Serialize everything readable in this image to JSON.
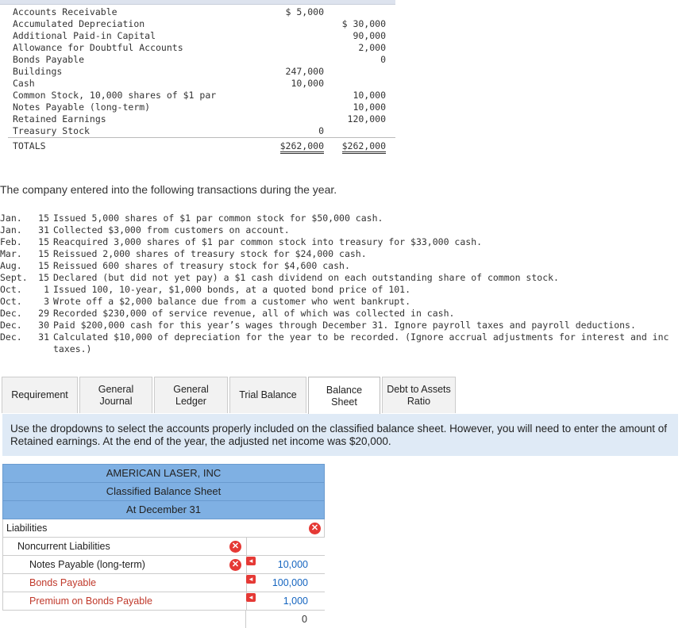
{
  "trial_balance": {
    "rows": [
      {
        "account": "Accounts Receivable",
        "debit": "$ 5,000",
        "credit": ""
      },
      {
        "account": "Accumulated Depreciation",
        "debit": "",
        "credit": "$ 30,000"
      },
      {
        "account": "Additional Paid-in Capital",
        "debit": "",
        "credit": "90,000"
      },
      {
        "account": "Allowance for Doubtful Accounts",
        "debit": "",
        "credit": "2,000"
      },
      {
        "account": "Bonds Payable",
        "debit": "",
        "credit": "0"
      },
      {
        "account": "Buildings",
        "debit": "247,000",
        "credit": ""
      },
      {
        "account": "Cash",
        "debit": "10,000",
        "credit": ""
      },
      {
        "account": "Common Stock, 10,000 shares of $1 par",
        "debit": "",
        "credit": "10,000"
      },
      {
        "account": "Notes Payable (long-term)",
        "debit": "",
        "credit": "10,000"
      },
      {
        "account": "Retained Earnings",
        "debit": "",
        "credit": "120,000"
      },
      {
        "account": "Treasury Stock",
        "debit": "0",
        "credit": ""
      }
    ],
    "totals": {
      "label": "TOTALS",
      "debit": "$262,000",
      "credit": "$262,000"
    }
  },
  "intro": "The company entered into the following transactions during the year.",
  "transactions": [
    {
      "month": "Jan.",
      "day": "15",
      "text": "Issued 5,000 shares of $1 par common stock for $50,000 cash."
    },
    {
      "month": "Jan.",
      "day": "31",
      "text": "Collected $3,000 from customers on account."
    },
    {
      "month": "Feb.",
      "day": "15",
      "text": "Reacquired 3,000 shares of $1 par common stock into treasury for $33,000 cash."
    },
    {
      "month": "Mar.",
      "day": "15",
      "text": "Reissued 2,000 shares of treasury stock for $24,000 cash."
    },
    {
      "month": "Aug.",
      "day": "15",
      "text": "Reissued 600 shares of treasury stock for $4,600 cash."
    },
    {
      "month": "Sept.",
      "day": "15",
      "text": "Declared (but did not yet pay) a $1 cash dividend on each outstanding share of common stock."
    },
    {
      "month": "Oct.",
      "day": "1",
      "text": "Issued 100, 10-year, $1,000 bonds, at a quoted bond price of 101."
    },
    {
      "month": "Oct.",
      "day": "3",
      "text": "Wrote off a $2,000 balance due from a customer who went bankrupt."
    },
    {
      "month": "Dec.",
      "day": "29",
      "text": "Recorded $230,000 of service revenue, all of which was collected in cash."
    },
    {
      "month": "Dec.",
      "day": "30",
      "text": "Paid $200,000 cash for this year’s wages through December 31. Ignore payroll taxes and payroll deductions."
    },
    {
      "month": "Dec.",
      "day": "31",
      "text": "Calculated $10,000 of depreciation for the year to be recorded. (Ignore accrual adjustments for interest and inc"
    },
    {
      "month": "",
      "day": "",
      "text": "taxes.)"
    }
  ],
  "tabs": [
    {
      "label": "Requirement"
    },
    {
      "label": "General Journal"
    },
    {
      "label": "General Ledger"
    },
    {
      "label": "Trial Balance"
    },
    {
      "label": "Balance Sheet"
    },
    {
      "label": "Debt to Assets Ratio"
    }
  ],
  "instructions": "Use the dropdowns to select the accounts properly included on the classified balance sheet. However, you will need to enter the amount of Retained earnings. At the end of the year, the adjusted net income was $20,000.",
  "balance_sheet": {
    "company": "AMERICAN LASER, INC",
    "title": "Classified Balance Sheet",
    "date": "At December 31",
    "section": "Liabilities",
    "subsection": "Noncurrent Liabilities",
    "rows": [
      {
        "account": "Notes Payable (long-term)",
        "amount": "10,000"
      },
      {
        "account": "Bonds Payable",
        "amount": "100,000"
      },
      {
        "account": "Premium on Bonds Payable",
        "amount": "1,000"
      },
      {
        "account": "",
        "amount": "0"
      }
    ]
  },
  "colors": {
    "header_blue": "#7fb0e3",
    "instruction_bg": "#dfeaf6",
    "error_red": "#e53935",
    "amount_blue": "#1565c0"
  }
}
